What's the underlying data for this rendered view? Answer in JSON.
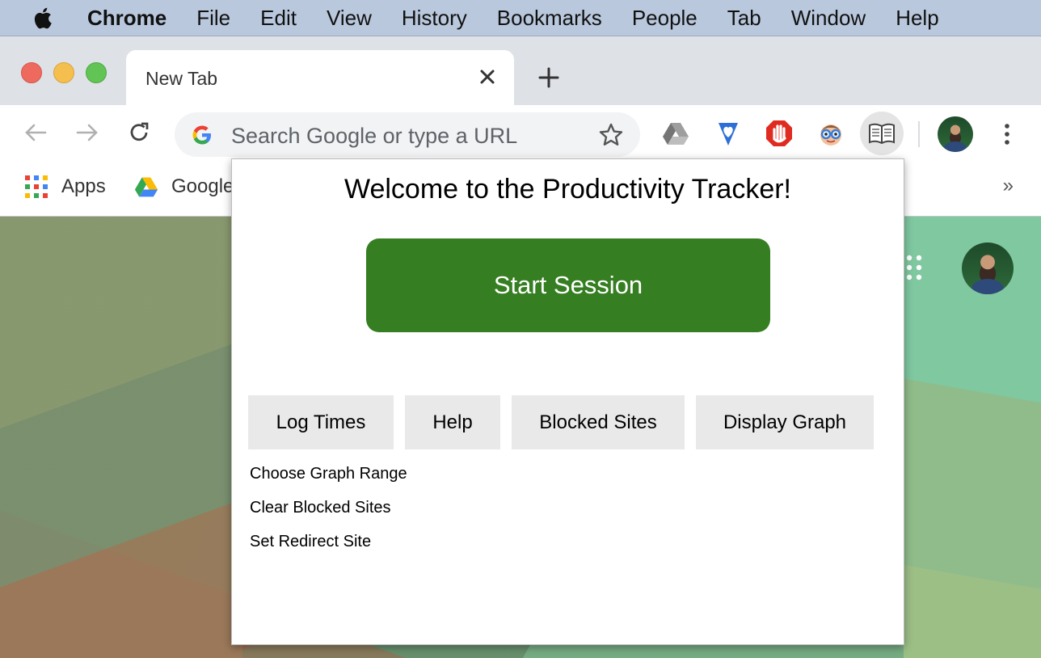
{
  "menubar": {
    "app_name": "Chrome",
    "items": [
      "File",
      "Edit",
      "View",
      "History",
      "Bookmarks",
      "People",
      "Tab",
      "Window",
      "Help"
    ]
  },
  "tabs": {
    "active_title": "New Tab"
  },
  "omnibox": {
    "placeholder": "Search Google or type a URL",
    "value": ""
  },
  "toolbar": {
    "extensions": [
      "google-drive-icon",
      "heart-shield-icon",
      "adblock-icon",
      "glasses-face-icon",
      "book-icon"
    ]
  },
  "bookmarks": {
    "items": [
      {
        "label": "Apps",
        "icon": "apps-grid-icon"
      },
      {
        "label": "Google",
        "icon": "google-drive-icon"
      }
    ],
    "overflow": "»"
  },
  "popup": {
    "title": "Welcome to the Productivity Tracker!",
    "start_label": "Start Session",
    "buttons": [
      "Log Times",
      "Help",
      "Blocked Sites",
      "Display Graph"
    ],
    "links": [
      "Choose Graph Range",
      "Clear Blocked Sites",
      "Set Redirect Site"
    ],
    "start_color": "#367e22",
    "button_bg": "#e9e9e9"
  }
}
